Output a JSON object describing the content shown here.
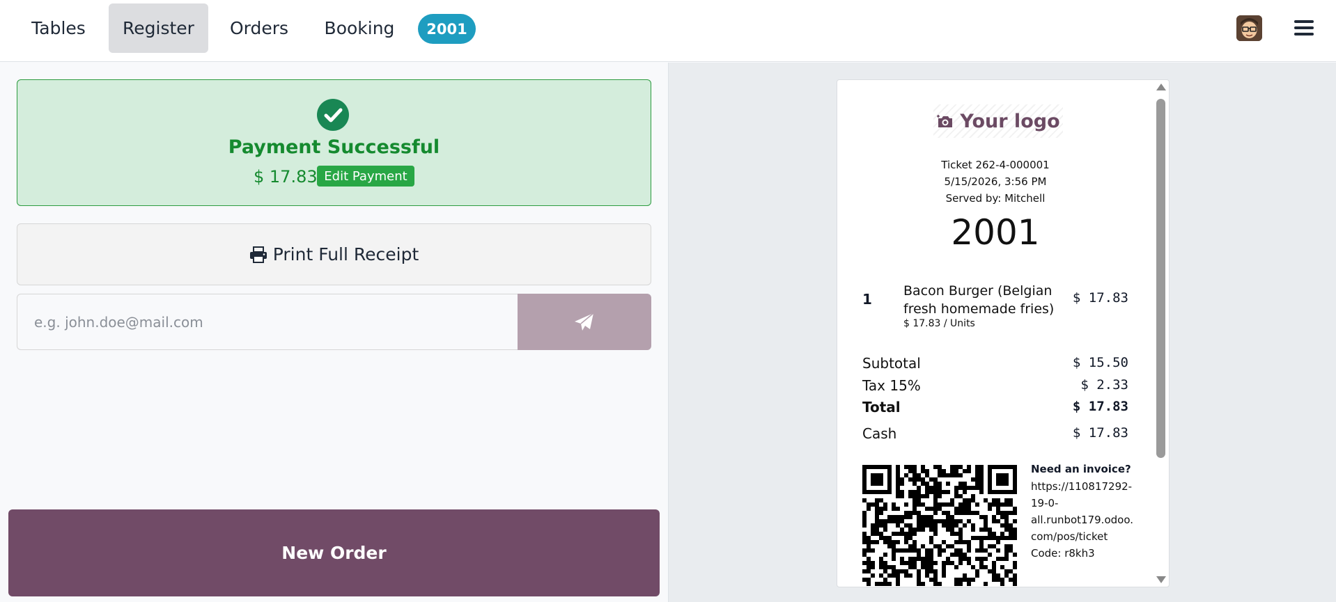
{
  "navbar": {
    "tabs": [
      {
        "label": "Tables",
        "active": false
      },
      {
        "label": "Register",
        "active": true
      },
      {
        "label": "Orders",
        "active": false
      },
      {
        "label": "Booking",
        "active": false
      }
    ],
    "order_badge": "2001",
    "icons": {
      "avatar": "user-avatar",
      "menu": "hamburger-menu-icon"
    }
  },
  "payment": {
    "status_title": "Payment Successful",
    "amount": "$ 17.83",
    "edit_label": "Edit Payment",
    "icon": "check-circle-icon"
  },
  "actions": {
    "print_label": "Print Full Receipt",
    "email_placeholder": "e.g. john.doe@mail.com",
    "new_order_label": "New Order"
  },
  "receipt": {
    "logo_text": "Your logo",
    "ticket": "Ticket 262-4-000001",
    "datetime": "5/15/2026, 3:56 PM",
    "served_by": "Served by: Mitchell",
    "order_number": "2001",
    "line_items": [
      {
        "qty": "1",
        "name": "Bacon Burger (Belgian fresh homemade fries)",
        "unit_price": "$ 17.83 / Units",
        "price": "$ 17.83"
      }
    ],
    "subtotal_label": "Subtotal",
    "subtotal": "$ 15.50",
    "tax_label": "Tax 15%",
    "tax": "$ 2.33",
    "total_label": "Total",
    "total": "$ 17.83",
    "cash_label": "Cash",
    "cash": "$ 17.83",
    "invoice_title": "Need an invoice?",
    "invoice_lines": [
      "https://110817292-",
      "19-0-",
      "all.runbot179.odoo.",
      "com/pos/ticket",
      "Code: r8kh3"
    ]
  },
  "colors": {
    "accent": "#714b67",
    "success": "#158a2f",
    "badge": "#1e9dc0"
  }
}
